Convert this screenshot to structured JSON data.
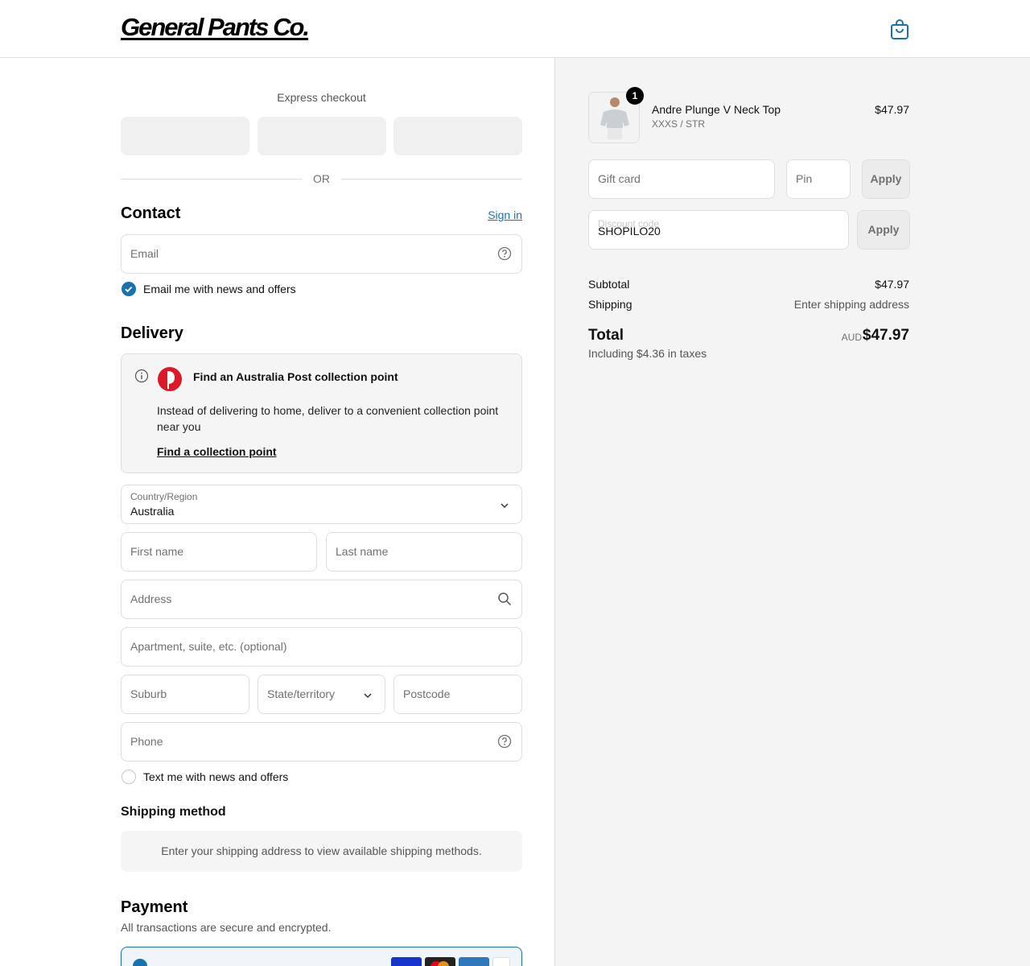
{
  "header": {
    "logo_text": "General Pants Co.",
    "cart_icon": "shopping-bag-icon"
  },
  "express": {
    "title": "Express checkout",
    "or_text": "OR"
  },
  "contact": {
    "title": "Contact",
    "sign_in": "Sign in",
    "email_placeholder": "Email",
    "news_label": "Email me with news and offers",
    "news_checked": true
  },
  "delivery": {
    "title": "Delivery",
    "collection": {
      "title": "Find an Australia Post collection point",
      "description": "Instead of delivering to home, deliver to a convenient collection point near you",
      "link": "Find a collection point"
    },
    "country_label": "Country/Region",
    "country_value": "Australia",
    "first_name": "First name",
    "last_name": "Last name",
    "address": "Address",
    "apartment": "Apartment, suite, etc. (optional)",
    "suburb": "Suburb",
    "state": "State/territory",
    "postcode": "Postcode",
    "phone": "Phone",
    "sms_label": "Text me with news and offers",
    "sms_checked": false
  },
  "shipping_method": {
    "title": "Shipping method",
    "message": "Enter your shipping address to view available shipping methods."
  },
  "payment": {
    "title": "Payment",
    "subtitle": "All transactions are secure and encrypted."
  },
  "summary": {
    "product": {
      "name": "Andre Plunge V Neck Top",
      "variant": "XXXS / STR",
      "price": "$47.97",
      "quantity": "1"
    },
    "gift_card_placeholder": "Gift card",
    "pin_placeholder": "Pin",
    "apply_label": "Apply",
    "discount_label": "Discount code",
    "discount_value": "SHOPILO20",
    "subtotal_label": "Subtotal",
    "subtotal_value": "$47.97",
    "shipping_label": "Shipping",
    "shipping_value": "Enter shipping address",
    "total_label": "Total",
    "currency": "AUD",
    "total_value": "$47.97",
    "tax_note": "Including $4.36 in taxes"
  },
  "colors": {
    "accent": "#1773b0",
    "sidebar_bg": "#f4f4f4"
  }
}
